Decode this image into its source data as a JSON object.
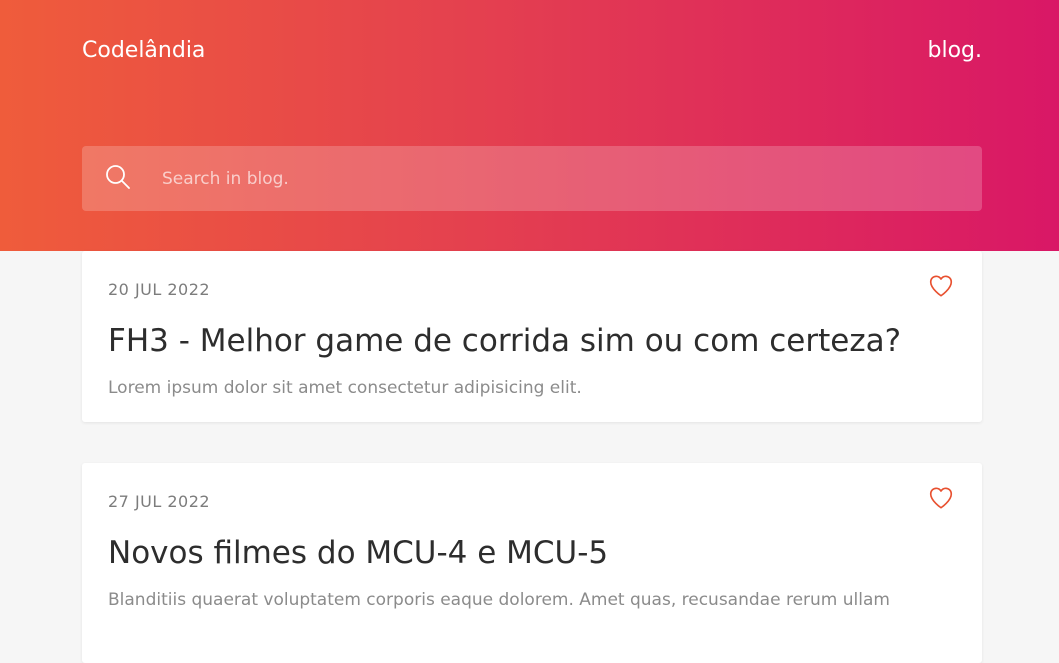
{
  "header": {
    "brand": "Codelândia",
    "blog_link": "blog."
  },
  "search": {
    "placeholder": "Search in blog.",
    "icon": "search-icon"
  },
  "posts": [
    {
      "date": "20 JUL 2022",
      "title": "FH3 - Melhor game de corrida sim ou com certeza?",
      "excerpt": "Lorem ipsum dolor sit amet consectetur adipisicing elit.",
      "icon": "heart-icon"
    },
    {
      "date": "27 JUL 2022",
      "title": "Novos filmes do MCU-4 e MCU-5",
      "excerpt": "Blanditiis quaerat voluptatem corporis eaque dolorem. Amet quas, recusandae rerum ullam",
      "icon": "heart-icon"
    }
  ],
  "colors": {
    "gradient_start": "#ef5c3b",
    "gradient_end": "#d91766",
    "accent": "#e8502f",
    "background": "#f6f6f6"
  }
}
